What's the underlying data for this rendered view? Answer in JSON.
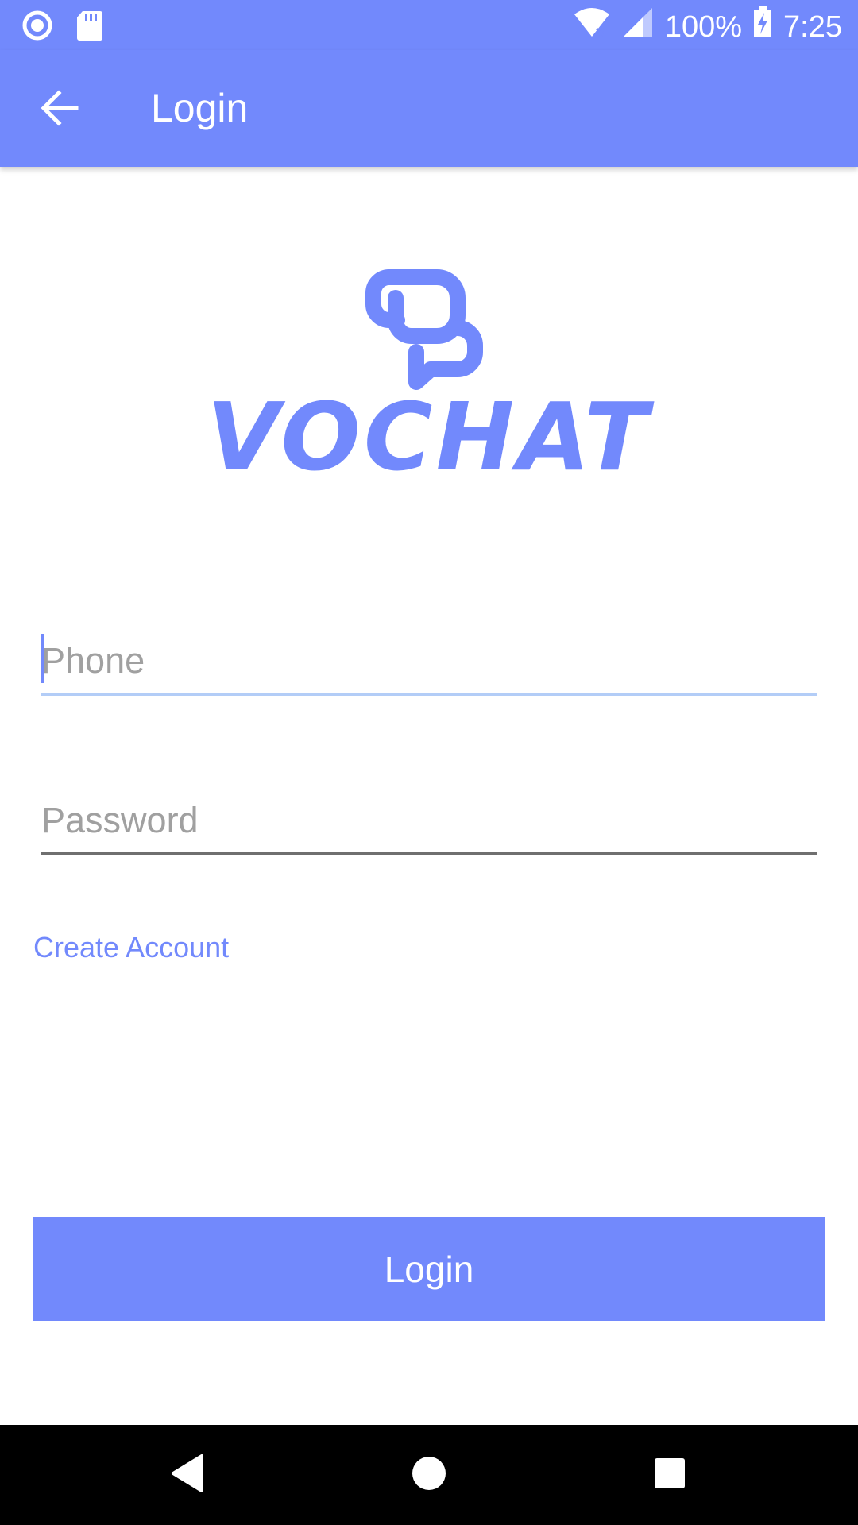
{
  "status_bar": {
    "battery": "100%",
    "time": "7:25",
    "left_icons": [
      "record-icon",
      "sd-card-icon"
    ],
    "right_icons": [
      "wifi-icon",
      "signal-icon",
      "battery-charging-icon"
    ]
  },
  "app_bar": {
    "title": "Login",
    "back_icon": "arrow-back-icon"
  },
  "logo": {
    "text": "VOCHAT",
    "icon": "chat-bubbles-icon",
    "color": "#7289fc"
  },
  "form": {
    "phone_placeholder": "Phone",
    "phone_value": "",
    "password_placeholder": "Password",
    "password_value": "",
    "create_account_label": "Create Account",
    "login_label": "Login"
  },
  "nav_bar": {
    "icons": [
      "back-triangle-icon",
      "home-circle-icon",
      "recents-square-icon"
    ]
  },
  "colors": {
    "accent": "#7289fc",
    "focus_underline": "#b3cdf7",
    "placeholder": "#a0a0a0"
  }
}
